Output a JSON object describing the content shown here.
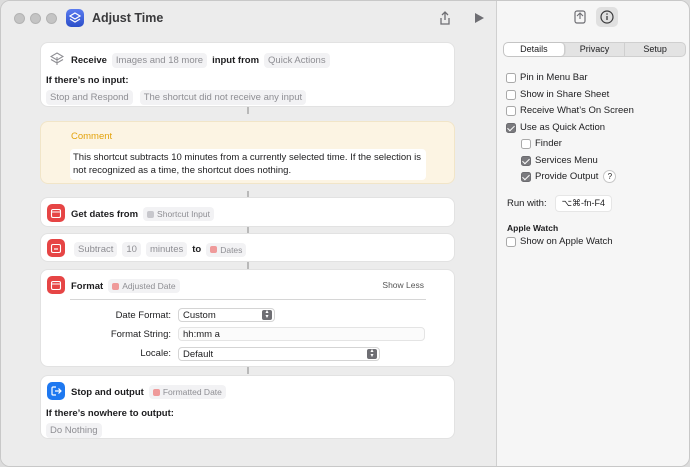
{
  "window": {
    "title": "Adjust Time"
  },
  "actions": {
    "receive": {
      "keyword": "Receive",
      "types": "Images and 18 more",
      "input_from": "input from",
      "source": "Quick Actions",
      "no_input_label": "If there’s no input:",
      "no_input_action": "Stop and Respond",
      "no_input_message": "The shortcut did not receive any input"
    },
    "comment": {
      "label": "Comment",
      "text": "This shortcut subtracts 10 minutes from a currently selected time. If the selection is not recognized as a time, the shortcut does nothing."
    },
    "get_dates": {
      "keyword": "Get dates from",
      "variable": "Shortcut Input"
    },
    "adjust": {
      "operation": "Subtract",
      "amount": "10",
      "unit": "minutes",
      "to": "to",
      "variable": "Dates"
    },
    "format": {
      "keyword": "Format",
      "variable": "Adjusted Date",
      "toggle": "Show Less",
      "date_format_label": "Date Format:",
      "date_format_value": "Custom",
      "format_string_label": "Format String:",
      "format_string_value": "hh:mm a",
      "locale_label": "Locale:",
      "locale_value": "Default"
    },
    "stop_output": {
      "keyword": "Stop and output",
      "variable": "Formatted Date",
      "nowhere_label": "If there’s nowhere to output:",
      "nowhere_action": "Do Nothing"
    }
  },
  "inspector": {
    "tabs": [
      "Details",
      "Privacy",
      "Setup"
    ],
    "selected_tab": "Details",
    "options": {
      "pin_menu_bar": {
        "label": "Pin in Menu Bar",
        "checked": false
      },
      "share_sheet": {
        "label": "Show in Share Sheet",
        "checked": false
      },
      "receive_onscreen": {
        "label": "Receive What’s On Screen",
        "checked": false
      },
      "quick_action": {
        "label": "Use as Quick Action",
        "checked": true
      },
      "finder": {
        "label": "Finder",
        "checked": false
      },
      "services_menu": {
        "label": "Services Menu",
        "checked": true
      },
      "provide_output": {
        "label": "Provide Output",
        "checked": true
      }
    },
    "help_glyph": "?",
    "run_with_label": "Run with:",
    "shortcut_keys": "⌥⌘-fn-F4",
    "apple_watch_title": "Apple Watch",
    "apple_watch_option": {
      "label": "Show on Apple Watch",
      "checked": false
    }
  },
  "colors": {
    "accent_red": "#e64545",
    "accent_blue": "#1e78f0",
    "comment_yellow": "#e3a20b",
    "comment_bg": "#fcf4e3"
  },
  "icons": {
    "app": "shortcuts-icon",
    "share": "share-icon",
    "run": "play-icon",
    "library": "library-icon",
    "info": "info-icon"
  }
}
